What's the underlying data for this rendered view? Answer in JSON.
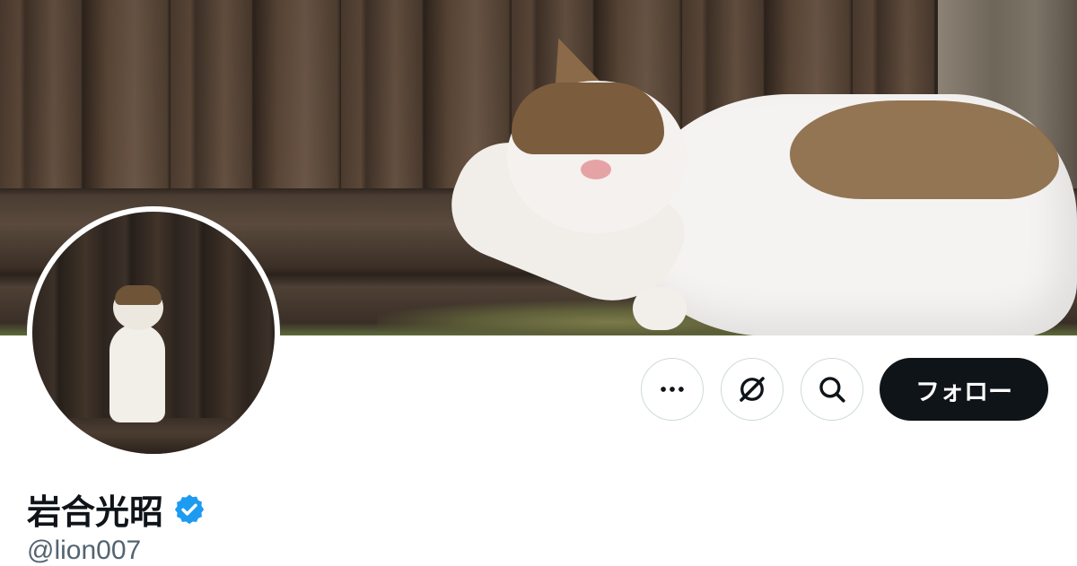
{
  "profile": {
    "display_name": "岩合光昭",
    "handle": "@lion007",
    "verified": true,
    "verified_icon": "verified-badge-icon",
    "verified_color": "#1d9bf0"
  },
  "actions": {
    "more_icon": "more-horizontal-icon",
    "grok_icon": "grok-icon",
    "search_icon": "search-icon",
    "follow_label": "フォロー"
  },
  "colors": {
    "follow_bg": "#0f1419",
    "follow_text": "#ffffff",
    "border": "#cfd9de",
    "handle": "#536471"
  }
}
